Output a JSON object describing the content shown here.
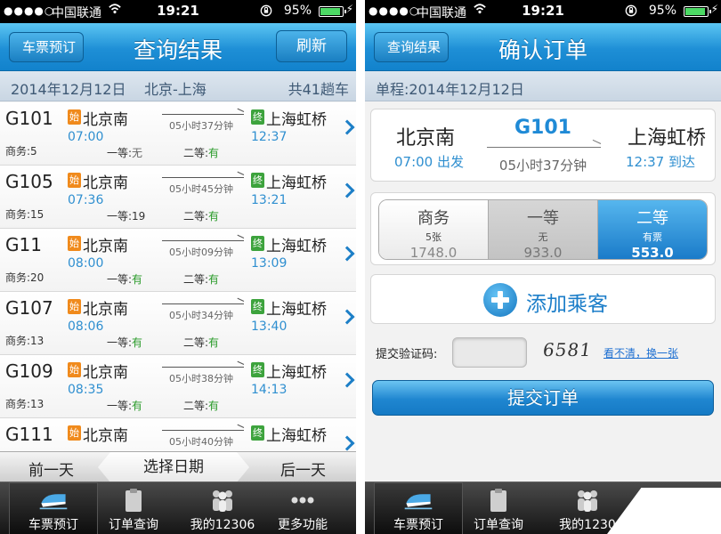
{
  "status": {
    "signal": "●●●●○",
    "carrier": "中国联通",
    "time": "19:21",
    "battery": "95%"
  },
  "left": {
    "nav": {
      "back": "车票预订",
      "title": "查询结果",
      "right": "刷新"
    },
    "summary": {
      "date": "2014年12月12日",
      "route": "北京-上海",
      "count": "共41趟车"
    },
    "trains": [
      {
        "code": "G101",
        "badge_start": "始",
        "from": "北京南",
        "dep": "07:00",
        "duration": "05小时37分钟",
        "badge_end": "终",
        "to": "上海虹桥",
        "arr": "12:37",
        "biz_label": "商务:",
        "biz": "5",
        "first_label": "一等:",
        "first": "无",
        "second_label": "二等:",
        "second": "有"
      },
      {
        "code": "G105",
        "badge_start": "始",
        "from": "北京南",
        "dep": "07:36",
        "duration": "05小时45分钟",
        "badge_end": "终",
        "to": "上海虹桥",
        "arr": "13:21",
        "biz_label": "商务:",
        "biz": "15",
        "first_label": "一等:",
        "first": "19",
        "second_label": "二等:",
        "second": "有"
      },
      {
        "code": "G11",
        "badge_start": "始",
        "from": "北京南",
        "dep": "08:00",
        "duration": "05小时09分钟",
        "badge_end": "终",
        "to": "上海虹桥",
        "arr": "13:09",
        "biz_label": "商务:",
        "biz": "20",
        "first_label": "一等:",
        "first": "有",
        "second_label": "二等:",
        "second": "有"
      },
      {
        "code": "G107",
        "badge_start": "始",
        "from": "北京南",
        "dep": "08:06",
        "duration": "05小时34分钟",
        "badge_end": "终",
        "to": "上海虹桥",
        "arr": "13:40",
        "biz_label": "商务:",
        "biz": "13",
        "first_label": "一等:",
        "first": "有",
        "second_label": "二等:",
        "second": "有"
      },
      {
        "code": "G109",
        "badge_start": "始",
        "from": "北京南",
        "dep": "08:35",
        "duration": "05小时38分钟",
        "badge_end": "终",
        "to": "上海虹桥",
        "arr": "14:13",
        "biz_label": "商务:",
        "biz": "13",
        "first_label": "一等:",
        "first": "有",
        "second_label": "二等:",
        "second": "有"
      },
      {
        "code": "G111",
        "badge_start": "始",
        "from": "北京南",
        "dep": "",
        "duration": "05小时40分钟",
        "badge_end": "终",
        "to": "上海虹桥",
        "arr": "",
        "biz_label": "",
        "biz": "",
        "first_label": "",
        "first": "",
        "second_label": "",
        "second": ""
      }
    ],
    "datebar": {
      "prev": "前一天",
      "pick": "选择日期",
      "next": "后一天"
    }
  },
  "tabs": [
    {
      "label": "车票预订",
      "icon": "train-icon"
    },
    {
      "label": "订单查询",
      "icon": "clipboard-icon"
    },
    {
      "label": "我的12306",
      "icon": "people-icon"
    },
    {
      "label": "更多功能",
      "icon": "more-icon"
    }
  ],
  "right": {
    "nav": {
      "back": "查询结果",
      "title": "确认订单"
    },
    "subtitle": "单程:2014年12月12日",
    "trip": {
      "from": "北京南",
      "dep": "07:00 出发",
      "train": "G101",
      "duration": "05小时37分钟",
      "to": "上海虹桥",
      "arr": "12:37 到达"
    },
    "seats": [
      {
        "name": "商务",
        "count": "5张",
        "price": "1748.0",
        "state": "normal"
      },
      {
        "name": "一等",
        "count": "无",
        "price": "933.0",
        "state": "disabled"
      },
      {
        "name": "二等",
        "count": "有票",
        "price": "553.0",
        "state": "selected"
      }
    ],
    "add_passenger": "添加乘客",
    "captcha": {
      "label": "提交验证码:",
      "value": "",
      "image_text": "6581",
      "refresh": "看不清，换一张"
    },
    "submit": "提交订单",
    "tabs_visible": [
      "车票预订",
      "订单查询",
      "我的1230"
    ]
  },
  "colors": {
    "accent": "#1f8ad6",
    "available": "#2a9b2a",
    "start_badge": "#f08a1c",
    "end_badge": "#3da33d"
  }
}
